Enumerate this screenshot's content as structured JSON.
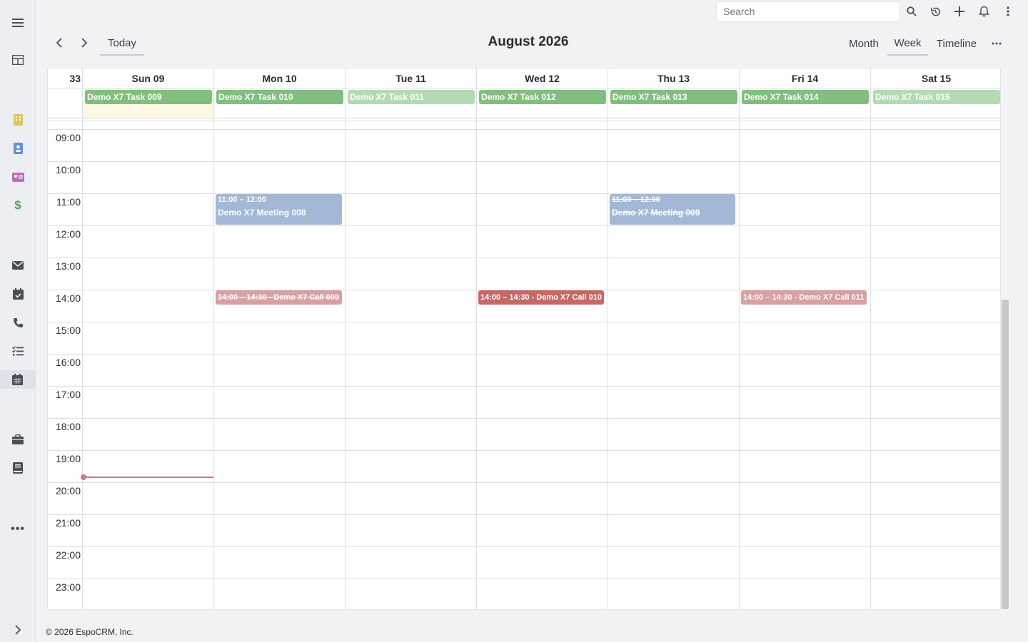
{
  "topbar": {
    "search_placeholder": "Search"
  },
  "toolbar": {
    "today_label": "Today",
    "title": "August 2026",
    "views": [
      "Month",
      "Week",
      "Timeline"
    ],
    "active_view": "Week"
  },
  "calendar": {
    "week_number": "33",
    "days": [
      "Sun 09",
      "Mon 10",
      "Tue 11",
      "Wed 12",
      "Thu 13",
      "Fri 14",
      "Sat 15"
    ],
    "hours": [
      "09:00",
      "10:00",
      "11:00",
      "12:00",
      "13:00",
      "14:00",
      "15:00",
      "16:00",
      "17:00",
      "18:00",
      "19:00",
      "20:00",
      "21:00",
      "22:00",
      "23:00"
    ],
    "allday_tasks": [
      {
        "label": "Demo X7 Task 009",
        "color": "#80bf7d"
      },
      {
        "label": "Demo X7 Task 010",
        "color": "#80bf7d"
      },
      {
        "label": "Demo X7 Task 011",
        "color": "#b3dbb1"
      },
      {
        "label": "Demo X7 Task 012",
        "color": "#80bf7d"
      },
      {
        "label": "Demo X7 Task 013",
        "color": "#80bf7d"
      },
      {
        "label": "Demo X7 Task 014",
        "color": "#80bf7d"
      },
      {
        "label": "Demo X7 Task 015",
        "color": "#b3dbb1"
      }
    ],
    "events": {
      "meeting_008": {
        "time": "11:00 – 12:00",
        "title": "Demo X7 Meeting 008",
        "color": "#a2b8d6"
      },
      "meeting_009": {
        "time": "11:00 – 12:00",
        "title": "Demo X7 Meeting 009",
        "color": "#a2b8d6"
      },
      "call_009": {
        "label": "14:00 – 14:30 - Demo X7 Call 009",
        "color": "#d8a0a2"
      },
      "call_010": {
        "label": "14:00 – 14:30 - Demo X7 Call 010",
        "color": "#c56866"
      },
      "call_011": {
        "label": "14:00 – 14:30 - Demo X7 Call 011",
        "color": "#d8a0a2"
      }
    }
  },
  "footer": {
    "copyright": "© 2026 EspoCRM, Inc."
  }
}
